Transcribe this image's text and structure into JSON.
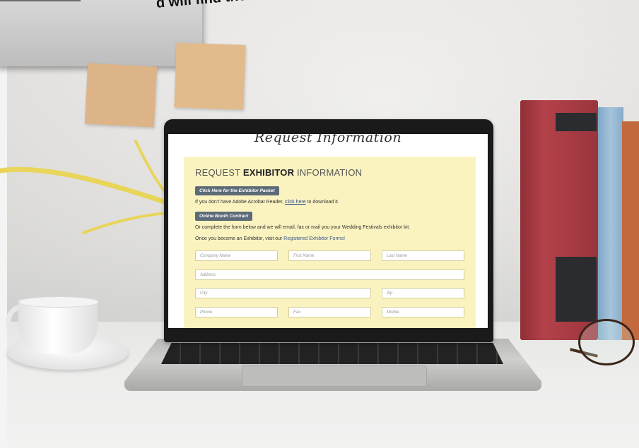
{
  "headline": "d will find the  \"Registered",
  "screen": {
    "script_title": "Request Information",
    "panel_title": {
      "pre": "REQUEST ",
      "bold": "EXHIBITOR",
      "post": " INFORMATION"
    },
    "packet_button": "Click Here for the Exhibitor Packet",
    "acrobat_pre": "If you don't have Adobe Acrobat Reader, ",
    "acrobat_link": "click here",
    "acrobat_post": " to download it.",
    "contract_button": "Online Booth Contract",
    "complete_text": "Or complete the form below and we will email, fax or mail you your Wedding Festivals exhibitor kit.",
    "exhibitor_pre": "Once you become an Exhibitor, visit our ",
    "exhibitor_link": "Registered Exhibitor Forms!",
    "fields": {
      "company": "Company Name",
      "first": "First Name",
      "last": "Last Name",
      "address": "Address",
      "city": "City",
      "zip": "Zip",
      "phone": "Phone",
      "fax": "Fax",
      "mobile": "Mobile"
    }
  },
  "colors": {
    "panel": "#faf3c0",
    "button": "#5d6b78",
    "arrow": "#e8d55a"
  }
}
